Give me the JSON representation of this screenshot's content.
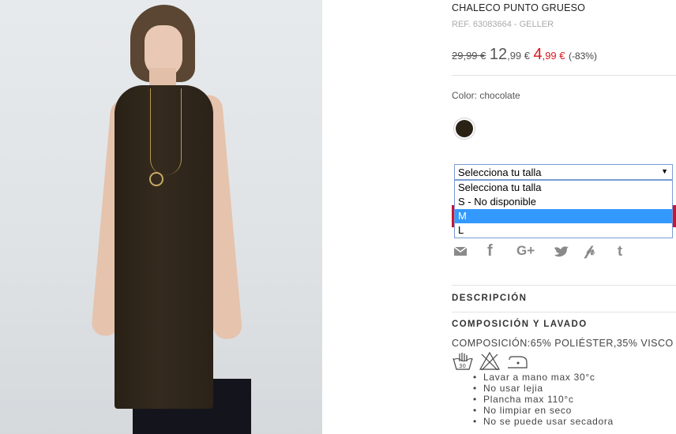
{
  "product": {
    "name": "CHALECO PUNTO GRUESO",
    "ref": "REF. 63083664 - GELLER",
    "price_original": "29,99 €",
    "price_previous_int": "12",
    "price_previous_dec": ",99 €",
    "price_current_int": "4",
    "price_current_dec": ",99 €",
    "discount": "(-83%)",
    "color_label": "Color: chocolate",
    "swatch_color": "#2b2216"
  },
  "size_select": {
    "selected": "Selecciona tu talla",
    "options": [
      "Selecciona tu talla",
      "S - No disponible",
      "M",
      "L"
    ],
    "highlighted_index": 2
  },
  "social": [
    "email-icon",
    "facebook-icon",
    "google-plus-icon",
    "twitter-icon",
    "pinterest-icon",
    "tumblr-icon"
  ],
  "sections": {
    "description": "DESCRIPCIÓN",
    "composition_care": "COMPOSICIÓN Y LAVADO",
    "composition_text": "COMPOSICIÓN:65% POLIÉSTER,35% VISCO",
    "care_icons": [
      "hand-wash-icon",
      "no-bleach-icon",
      "iron-110-icon"
    ],
    "care_list": [
      "Lavar a mano max 30°c",
      "No usar lejia",
      "Plancha max 110°c",
      "No limpiar en seco",
      "No se puede usar secadora"
    ]
  },
  "colors": {
    "sale_red": "#d9171e",
    "select_highlight": "#3399ff",
    "cta_red": "#c5163a"
  }
}
